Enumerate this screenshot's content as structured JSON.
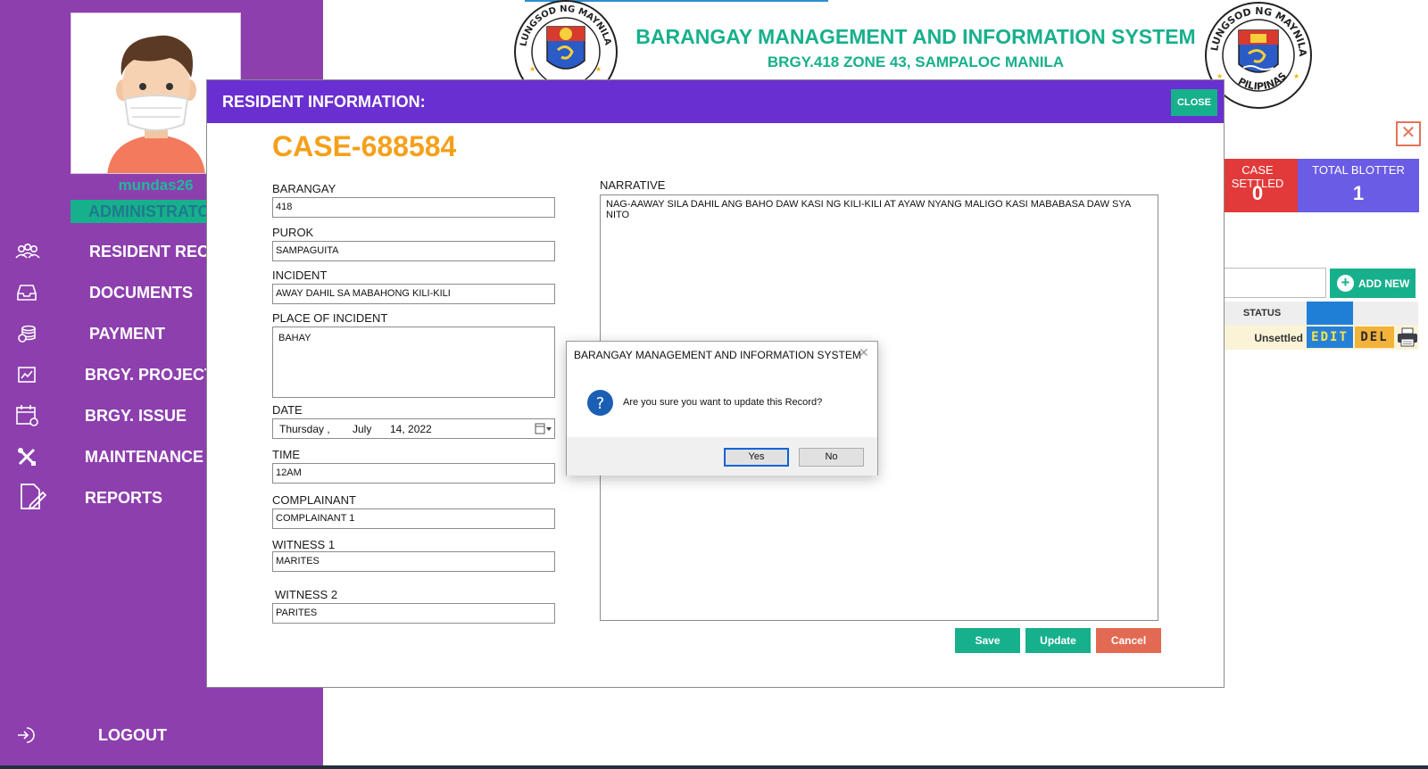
{
  "user": {
    "username": "mundas26",
    "role": "ADMINISTRATOR"
  },
  "nav": {
    "resident_records": "RESIDENT RECORDS",
    "documents": "DOCUMENTS",
    "payment": "PAYMENT",
    "brgy_project": "BRGY. PROJECT",
    "brgy_issue": "BRGY. ISSUE",
    "maintenance": "MAINTENANCE",
    "reports": "REPORTS",
    "logout": "LOGOUT"
  },
  "header": {
    "title": "BARANGAY MANAGEMENT AND INFORMATION SYSTEM",
    "subtitle": "BRGY.418 ZONE 43, SAMPALOC MANILA",
    "logo_left_ring_text": "LUNGSOD NG MAYNILA",
    "logo_right_ring_top": "LUNGSOD NG MAYNILA",
    "logo_right_ring_bottom": "PILIPINAS"
  },
  "stats": {
    "case_settled_label": "CASE SETTLED",
    "case_settled_value": "0",
    "total_blotter_label": "TOTAL BLOTTER",
    "total_blotter_value": "1"
  },
  "table": {
    "add_new_label": "ADD NEW",
    "status_header": "STATUS",
    "rows": [
      {
        "status": "Unsettled",
        "edit_label": "EDIT",
        "del_label": "DEL"
      }
    ]
  },
  "modal": {
    "title": "RESIDENT INFORMATION:",
    "close_label": "CLOSE",
    "case_no": "CASE-688584",
    "fields": {
      "barangay_label": "BARANGAY",
      "barangay_value": "418",
      "purok_label": "PUROK",
      "purok_value": "SAMPAGUITA",
      "incident_label": "INCIDENT",
      "incident_value": "AWAY DAHIL SA MABAHONG KILI-KILI",
      "place_label": "PLACE OF INCIDENT",
      "place_value": "BAHAY",
      "date_label": "DATE",
      "date_weekday": "Thursday ,",
      "date_month": "July",
      "date_day_year": "14, 2022",
      "time_label": "TIME",
      "time_value": "12AM",
      "complainant_label": "COMPLAINANT",
      "complainant_value": "COMPLAINANT 1",
      "witness1_label": "WITNESS 1",
      "witness1_value": "MARITES",
      "witness2_label": "WITNESS 2",
      "witness2_value": "PARITES",
      "narrative_label": "NARRATIVE",
      "narrative_value": "NAG-AAWAY SILA DAHIL ANG BAHO DAW KASI NG KILI-KILI AT AYAW NYANG MALIGO KASI MABABASA DAW SYA NITO"
    },
    "buttons": {
      "save": "Save",
      "update": "Update",
      "cancel": "Cancel"
    }
  },
  "dialog": {
    "title": "BARANGAY MANAGEMENT AND INFORMATION SYSTEM",
    "message": "Are you sure you want to update this Record?",
    "yes": "Yes",
    "no": "No"
  },
  "colors": {
    "sidebar": "#8d3fae",
    "accent_green": "#17b08c",
    "modal_header": "#6a2fd0",
    "case_orange": "#f5a01a",
    "cancel_red": "#e36a52"
  }
}
